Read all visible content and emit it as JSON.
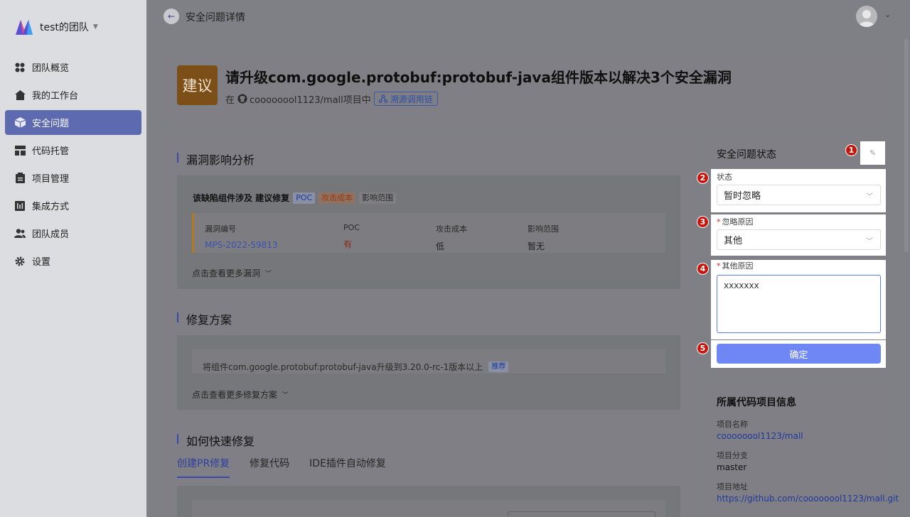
{
  "colors": {
    "accent": "#3949a8",
    "active_nav": "#5d6ab0",
    "suggest_badge": "#7c4f18",
    "annotation_marker": "#c8140a",
    "confirm_button": "#6f87f5"
  },
  "team": {
    "name": "test的团队",
    "logo_icon": "team-logo-icon"
  },
  "sidebar": {
    "items": [
      {
        "label": "团队概览",
        "icon": "overview-icon"
      },
      {
        "label": "我的工作台",
        "icon": "home-icon"
      },
      {
        "label": "安全问题",
        "icon": "cube-icon",
        "active": true
      },
      {
        "label": "代码托管",
        "icon": "layout-icon"
      },
      {
        "label": "项目管理",
        "icon": "clipboard-icon"
      },
      {
        "label": "集成方式",
        "icon": "integration-icon"
      },
      {
        "label": "团队成员",
        "icon": "members-icon"
      },
      {
        "label": "设置",
        "icon": "gear-icon"
      }
    ]
  },
  "header": {
    "title": "安全问题详情"
  },
  "issue": {
    "badge": "建议",
    "title": "请升级com.google.protobuf:protobuf-java组件版本以解决3个安全漏洞",
    "sub_prefix": "在",
    "repo": "coooooool1123/mall项目中",
    "trace_label": "溯源调用链"
  },
  "analysis": {
    "heading": "漏洞影响分析",
    "summary": "该缺陷组件涉及 建议修复",
    "tags": [
      "POC",
      "攻击成本",
      "影响范围"
    ],
    "columns": [
      "漏洞编号",
      "POC",
      "攻击成本",
      "影响范围"
    ],
    "row": {
      "id": "MPS-2022-59813",
      "poc": "有",
      "cost": "低",
      "scope": "暂无"
    },
    "more": "点击查看更多漏洞"
  },
  "fix": {
    "heading": "修复方案",
    "text": "将组件com.google.protobuf:protobuf-java升级到3.20.0-rc-1版本以上",
    "tag": "推荐",
    "more": "点击查看更多修复方案"
  },
  "quickfix": {
    "heading": "如何快速修复",
    "tabs": [
      "创建PR修复",
      "修复代码",
      "IDE插件自动修复"
    ]
  },
  "status_panel": {
    "title": "安全问题状态",
    "status_label": "状态",
    "status_value": "暂时忽略",
    "ignore_label": "忽略原因",
    "ignore_value": "其他",
    "other_label": "其他原因",
    "other_value": "xxxxxxx",
    "confirm": "确定",
    "markers": [
      "1",
      "2",
      "3",
      "4",
      "5"
    ]
  },
  "project_info": {
    "title": "所属代码项目信息",
    "name_label": "项目名称",
    "name_value": "coooooool1123/mall",
    "branch_label": "项目分支",
    "branch_value": "master",
    "url_label": "项目地址",
    "url_value": "https://github.com/coooooool1123/mall.git"
  }
}
